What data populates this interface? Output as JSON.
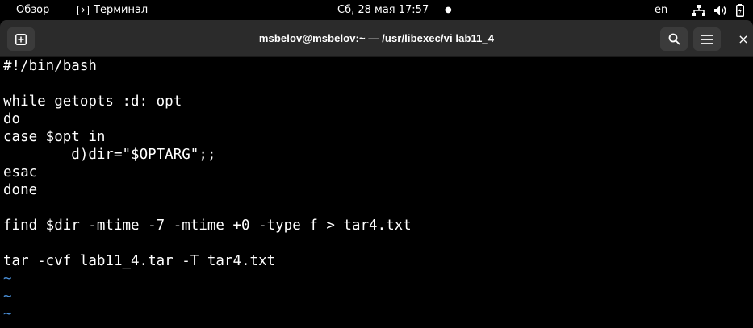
{
  "topbar": {
    "overview": "Обзор",
    "app_name": "Терминал",
    "clock": "Сб, 28 мая  17:57",
    "indicator": "●",
    "language": "en",
    "icons": [
      "network-icon",
      "volume-icon",
      "battery-icon"
    ]
  },
  "window": {
    "title": "msbelov@msbelov:~ — /usr/libexec/vi lab11_4",
    "buttons": {
      "new_tab": "new-tab-icon",
      "search": "search-icon",
      "menu": "hamburger-menu-icon",
      "close": "×"
    }
  },
  "editor": {
    "lines": [
      "#!/bin/bash",
      "",
      "while getopts :d: opt",
      "do",
      "case $opt in",
      "        d)dir=\"$OPTARG\";;",
      "esac",
      "done",
      "",
      "find $dir -mtime -7 -mtime +0 -type f > tar4.txt",
      "",
      "tar -cvf lab11_4.tar -T tar4.txt"
    ],
    "empty_marker": "~",
    "empty_lines": 3
  },
  "colors": {
    "terminal_bg": "#000000",
    "terminal_fg": "#ffffff",
    "header_bg": "#2b2b2b",
    "tilde": "#4a90d9"
  }
}
